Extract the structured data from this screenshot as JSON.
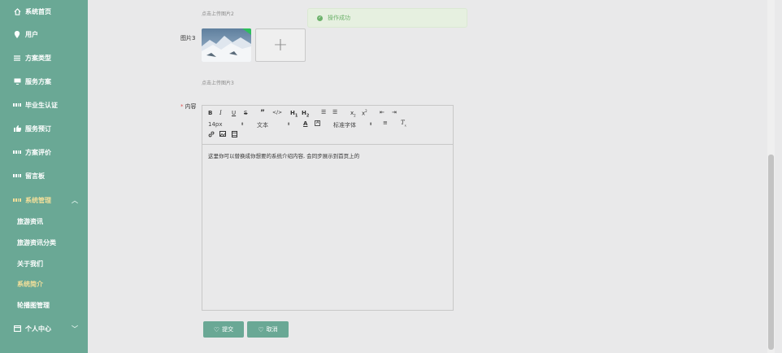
{
  "sidebar": {
    "items": [
      {
        "label": "系统首页",
        "icon": "home-icon"
      },
      {
        "label": "用户",
        "icon": "location-pin-icon"
      },
      {
        "label": "方案类型",
        "icon": "list-icon"
      },
      {
        "label": "服务方案",
        "icon": "monitor-icon"
      },
      {
        "label": "毕业生认证",
        "icon": "grid-icon"
      },
      {
        "label": "服务预订",
        "icon": "thumbs-up-icon"
      },
      {
        "label": "方案评价",
        "icon": "grid-icon"
      },
      {
        "label": "留言板",
        "icon": "grid-icon"
      },
      {
        "label": "系统管理",
        "icon": "grid-icon"
      }
    ],
    "sub_items": [
      "旅游资讯",
      "旅游资讯分类",
      "关于我们",
      "系统简介",
      "轮播图管理"
    ],
    "personal": {
      "label": "个人中心",
      "icon": "calendar-icon"
    }
  },
  "form": {
    "hint_image2": "点击上传图片2",
    "image3_label": "图片3",
    "hint_image3": "点击上传图片3",
    "content_label": "内容",
    "required_mark": "*",
    "upload_plus": "+",
    "editor": {
      "font_size": "14px",
      "paragraph": "文本",
      "font_family": "标准字体",
      "body_text": "这里你可以替换成你想要的系统介绍内容, 会同步展示到首页上的"
    },
    "submit_label": "提交",
    "cancel_label": "取消"
  },
  "toast": {
    "message": "操作成功"
  },
  "colors": {
    "sidebar": "#6aa895",
    "active": "#f3df9a",
    "toast_text": "#6db26b"
  }
}
